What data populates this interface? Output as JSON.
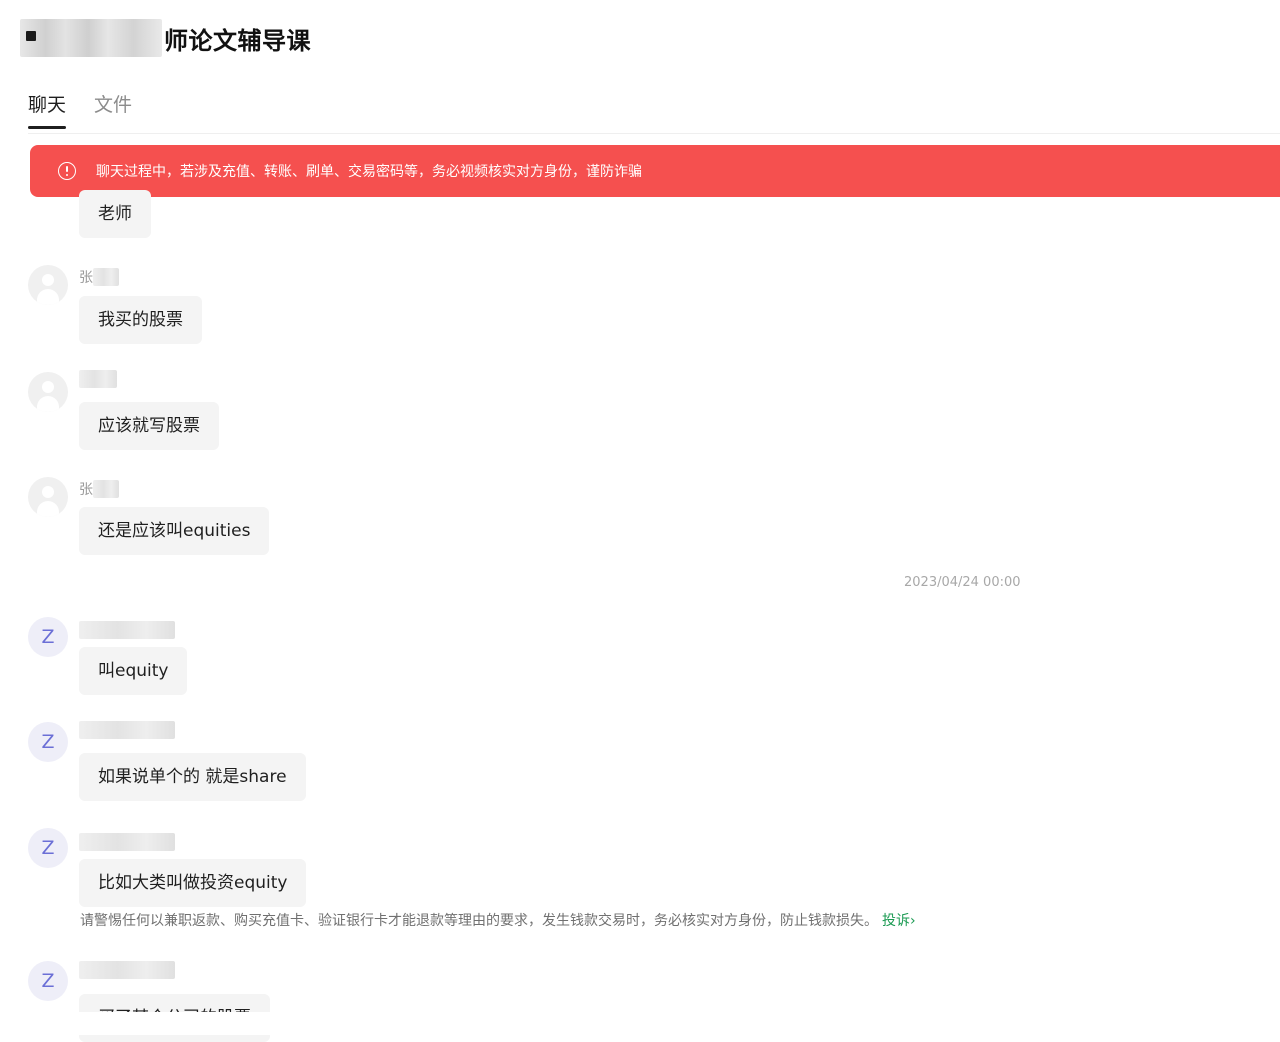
{
  "header": {
    "title_suffix": "师论文辅导课"
  },
  "tabs": [
    {
      "label": "聊天"
    },
    {
      "label": "文件"
    }
  ],
  "warning_banner": {
    "text": "聊天过程中，若涉及充值、转账、刷单、交易密码等，务必视频核实对方身份，谨防诈骗"
  },
  "messages": [
    {
      "sender": "",
      "avatar": "",
      "text": "老师"
    },
    {
      "sender": "张",
      "avatar": "",
      "text": "我买的股票"
    },
    {
      "sender": "",
      "avatar": "",
      "text": "应该就写股票"
    },
    {
      "sender": "张",
      "avatar": "",
      "text": "还是应该叫equities"
    },
    {
      "sender": "",
      "avatar": "Z",
      "text": "叫equity"
    },
    {
      "sender": "",
      "avatar": "Z",
      "text": "如果说单个的 就是share"
    },
    {
      "sender": "",
      "avatar": "Z",
      "text": "比如大类叫做投资equity"
    },
    {
      "sender": "",
      "avatar": "Z",
      "text": "买了某个公司的股票"
    }
  ],
  "timestamp": "2023/04/24 00:00",
  "notice": {
    "text": "请警惕任何以兼职返款、购买充值卡、验证银行卡才能退款等理由的要求，发生钱款交易时，务必核实对方身份，防止钱款损失。",
    "link_label": "投诉",
    "link_chevron": "›"
  }
}
